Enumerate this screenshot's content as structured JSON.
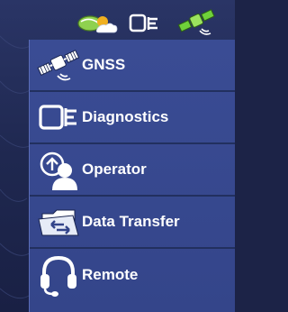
{
  "status_bar": {
    "icons": [
      "gps-weather-icon",
      "diagnostics-icon",
      "satellite-signal-icon"
    ]
  },
  "menu": {
    "items": [
      {
        "label": "GNSS",
        "icon": "satellite-icon"
      },
      {
        "label": "Diagnostics",
        "icon": "diagnostics-icon"
      },
      {
        "label": "Operator",
        "icon": "operator-icon"
      },
      {
        "label": "Data Transfer",
        "icon": "data-transfer-icon"
      },
      {
        "label": "Remote",
        "icon": "headset-icon"
      }
    ]
  },
  "colors": {
    "panel": "#3a4c94",
    "background": "#1f2850",
    "text": "#ffffff",
    "satellite_green": "#6fd13a"
  }
}
